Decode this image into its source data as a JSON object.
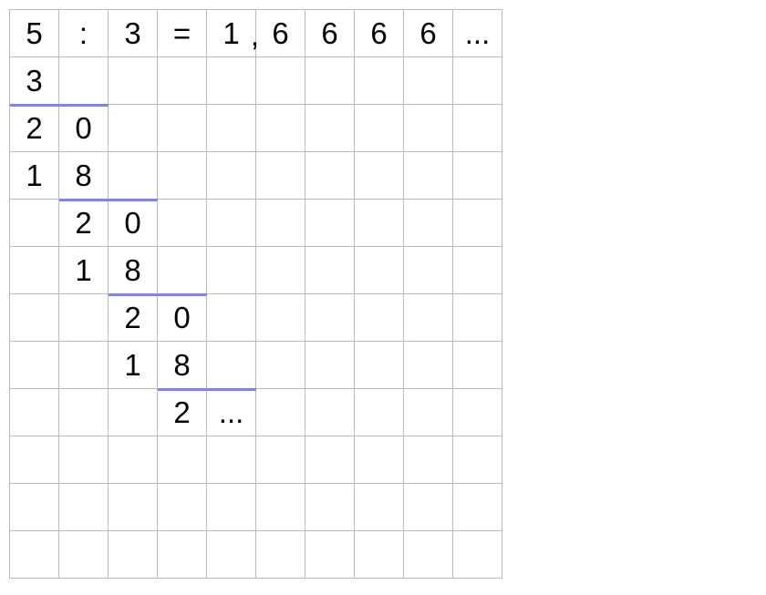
{
  "cells": {
    "r0c0": "5",
    "r0c1": ":",
    "r0c2": "3",
    "r0c3": "=",
    "r0c4_digit": "1",
    "r0c4_comma": ",",
    "r0c5": "6",
    "r0c6": "6",
    "r0c7": "6",
    "r0c8": "6",
    "r0c9": "...",
    "r1c0": "3",
    "r2c0": "2",
    "r2c1": "0",
    "r3c0": "1",
    "r3c1": "8",
    "r4c1": "2",
    "r4c2": "0",
    "r5c1": "1",
    "r5c2": "8",
    "r6c2": "2",
    "r6c3": "0",
    "r7c2": "1",
    "r7c3": "8",
    "r8c3": "2",
    "r8c4": "..."
  }
}
